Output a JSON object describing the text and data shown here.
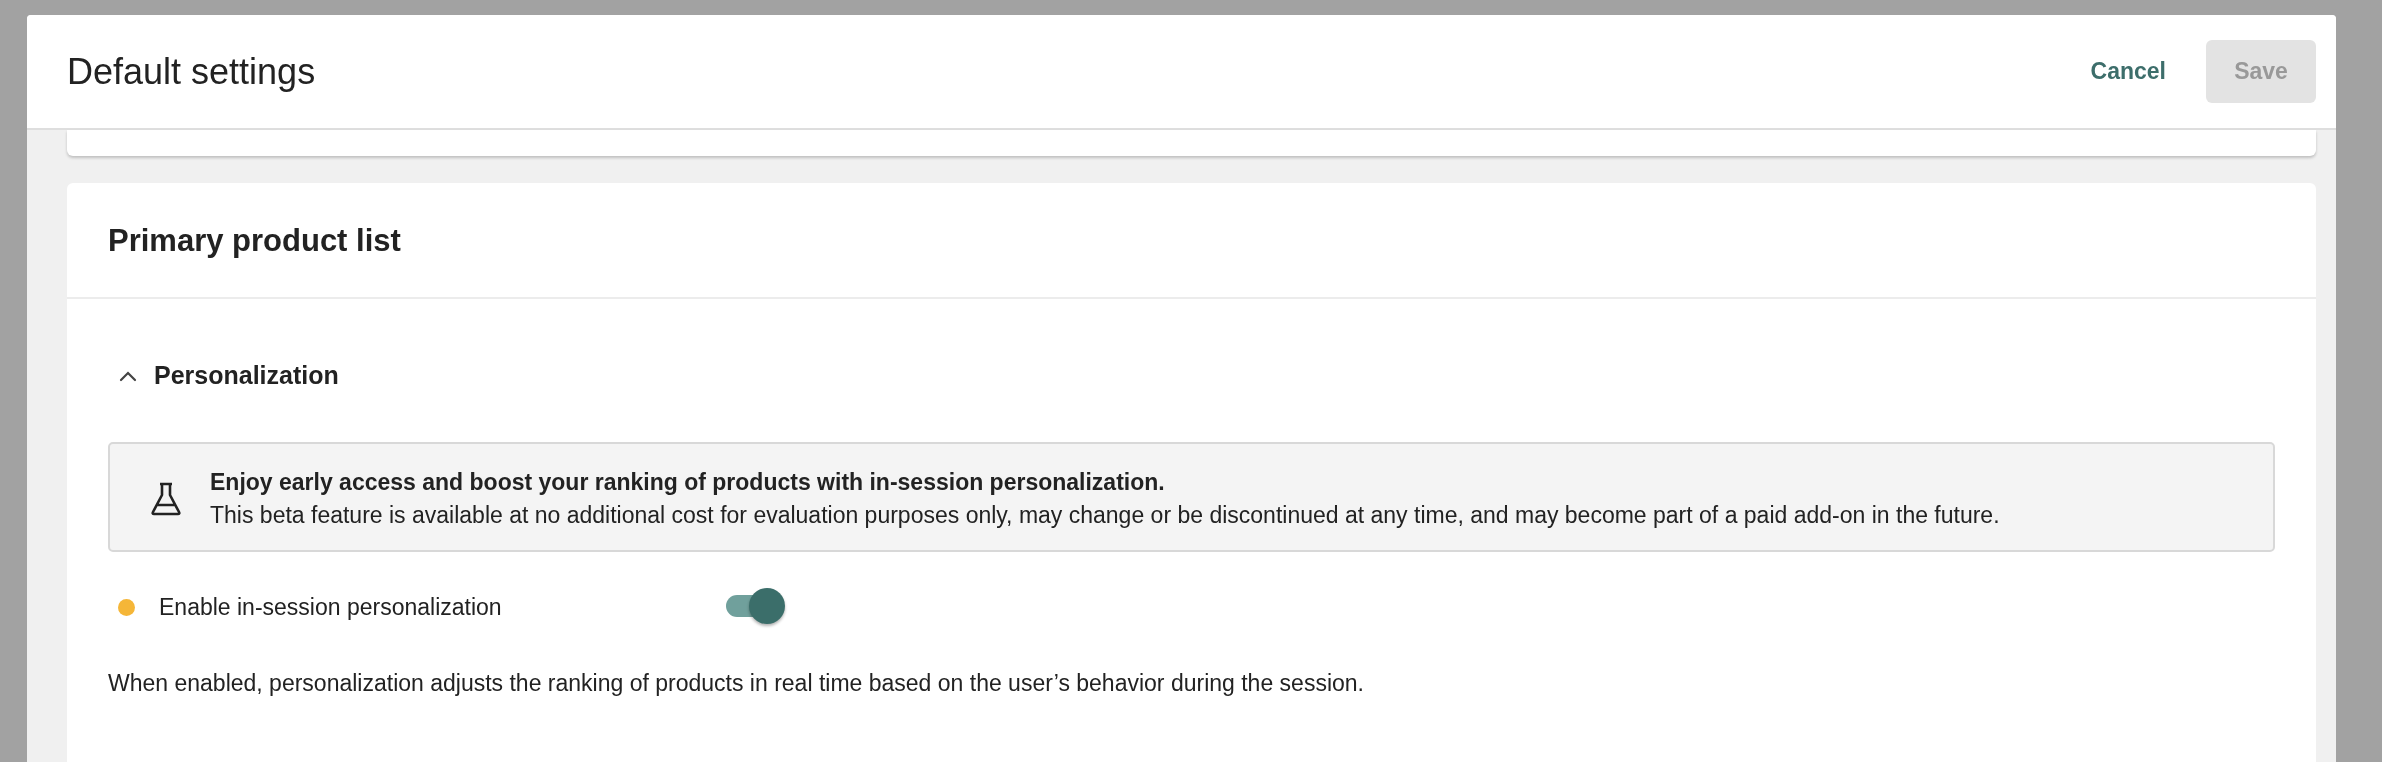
{
  "modal": {
    "title": "Default settings",
    "buttons": [
      {
        "label": "Cancel",
        "kind": "link",
        "disabled": false
      },
      {
        "label": "Save",
        "kind": "primary",
        "disabled": true
      }
    ]
  },
  "section": {
    "title": "Primary product list",
    "group": {
      "title": "Personalization",
      "expanded": true,
      "notice": {
        "headline": "Enjoy early access and boost your ranking of products with in-session personalization.",
        "body": "This beta feature is available at no additional cost for evaluation purposes only, may change or be discontinued at any time, and may become part of a paid add-on in the future."
      },
      "setting": {
        "label": "Enable in-session personalization",
        "color": "#f5b638",
        "on": true
      },
      "description": "When enabled, personalization adjusts the ranking of products in real time based on the user’s behavior during the session."
    }
  }
}
